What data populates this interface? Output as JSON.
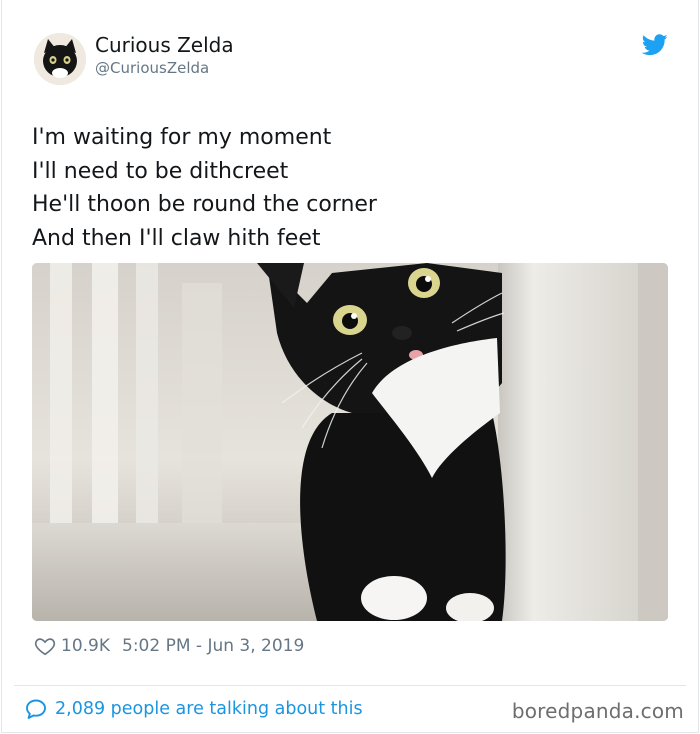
{
  "tweet": {
    "display_name": "Curious Zelda",
    "handle": "@CuriousZelda",
    "lines": [
      "I'm waiting for my moment",
      "I'll need to be dithcreet",
      "He'll thoon be round the corner",
      "And then I'll claw hith feet"
    ],
    "likes": "10.9K",
    "timestamp": "5:02 PM - Jun 3, 2019",
    "talking": "2,089 people are talking about this"
  },
  "icons": {
    "brand": "twitter-bird-icon",
    "like": "heart-icon",
    "reply": "speech-bubble-icon"
  },
  "colors": {
    "twitter_blue": "#1da1f2",
    "link_blue": "#1b95e0",
    "meta_gray": "#657786"
  },
  "watermark": "boredpanda.com"
}
